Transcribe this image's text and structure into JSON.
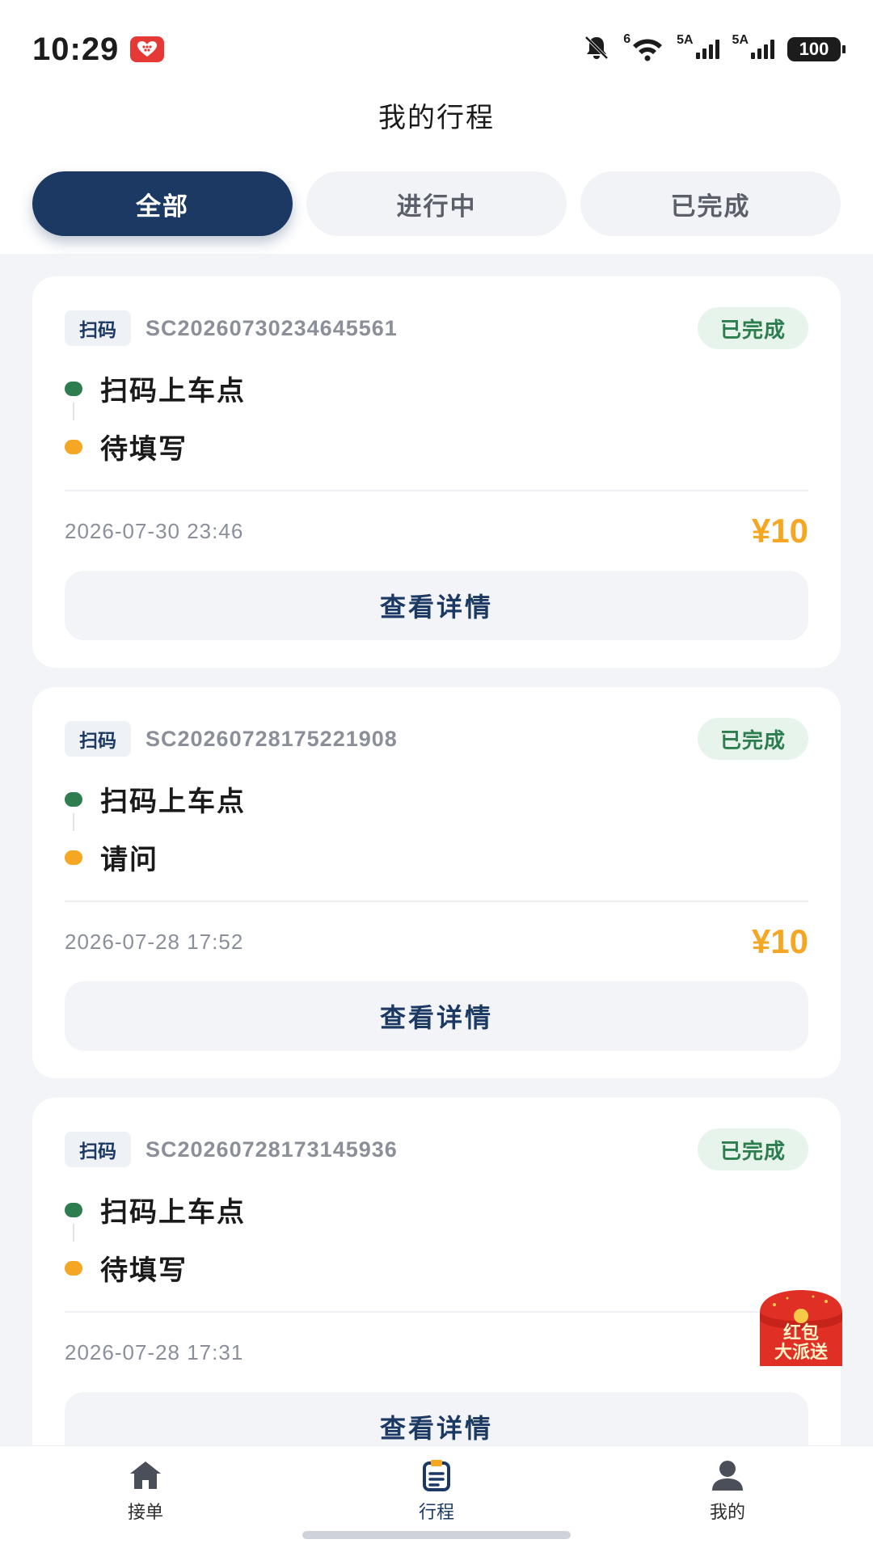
{
  "status_bar": {
    "time": "10:29",
    "network_1": "5A",
    "network_2": "5A",
    "wifi_label": "6",
    "battery": "100"
  },
  "header": {
    "title": "我的行程"
  },
  "tabs": [
    {
      "label": "全部",
      "active": true
    },
    {
      "label": "进行中",
      "active": false
    },
    {
      "label": "已完成",
      "active": false
    }
  ],
  "trips": [
    {
      "type": "扫码",
      "order_no": "SC20260730234645561",
      "status": "已完成",
      "from": "扫码上车点",
      "to": "待填写",
      "time": "2026-07-30 23:46",
      "price": "¥10",
      "action": "查看详情"
    },
    {
      "type": "扫码",
      "order_no": "SC20260728175221908",
      "status": "已完成",
      "from": "扫码上车点",
      "to": "请问",
      "time": "2026-07-28 17:52",
      "price": "¥10",
      "action": "查看详情"
    },
    {
      "type": "扫码",
      "order_no": "SC20260728173145936",
      "status": "已完成",
      "from": "扫码上车点",
      "to": "待填写",
      "time": "2026-07-28 17:31",
      "price": "¥",
      "action": "查看详情"
    }
  ],
  "promo": {
    "line1": "红包",
    "line2": "大派送"
  },
  "bottom_nav": [
    {
      "label": "接单",
      "icon": "home-icon",
      "active": false
    },
    {
      "label": "行程",
      "icon": "clipboard-icon",
      "active": true
    },
    {
      "label": "我的",
      "icon": "person-icon",
      "active": false
    }
  ],
  "colors": {
    "accent": "#1c3963",
    "price": "#f5a623",
    "status_green": "#2e7d4f",
    "origin_dot": "#2e7d4f",
    "destination_dot": "#f5a623"
  }
}
